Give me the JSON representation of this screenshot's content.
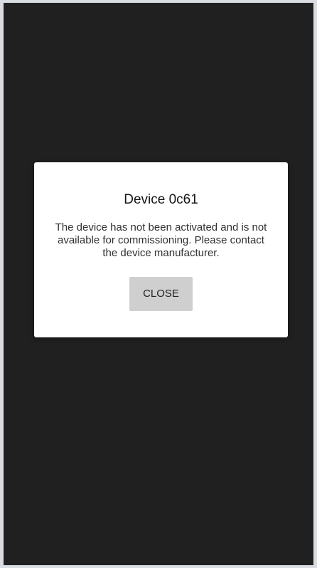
{
  "dialog": {
    "title": "Device 0c61",
    "message": "The device has not been activated and is not available for commissioning. Please contact the device manufacturer.",
    "close_label": "CLOSE"
  },
  "colors": {
    "screen_background": "#202020",
    "dialog_background": "#ffffff",
    "button_background": "#cfcfcf",
    "outer_border": "#d9dde2"
  }
}
